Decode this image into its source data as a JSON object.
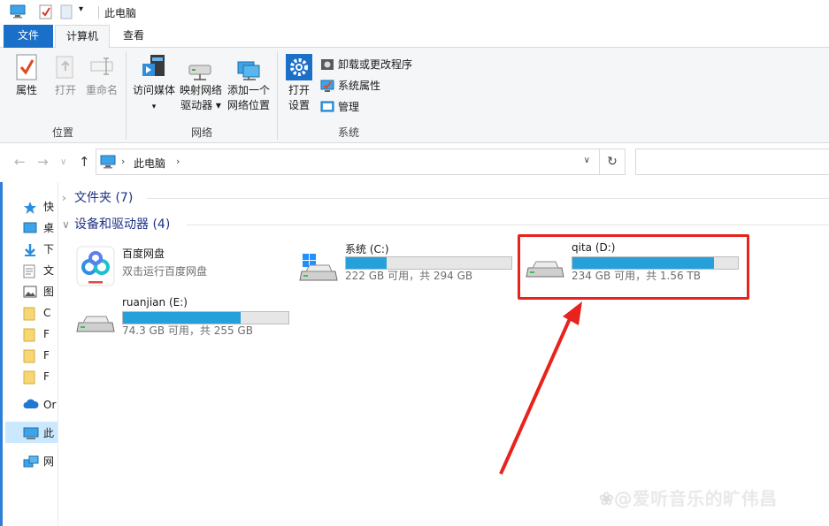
{
  "window": {
    "title": "此电脑",
    "qat_dropdown": "▾"
  },
  "ribbon_tabs": [
    {
      "label": "文件"
    },
    {
      "label": "计算机"
    },
    {
      "label": "查看"
    }
  ],
  "ribbon": {
    "location_group": {
      "label": "位置",
      "properties": "属性",
      "open": "打开",
      "rename": "重命名"
    },
    "network_group": {
      "label": "网络",
      "access_media_line1": "访问媒体",
      "access_media_caret": "▾",
      "map_drive_line1": "映射网络",
      "map_drive_line2": "驱动器 ▾",
      "add_location_line1": "添加一个",
      "add_location_line2": "网络位置"
    },
    "system_group": {
      "label": "系统",
      "open_settings_line1": "打开",
      "open_settings_line2": "设置",
      "uninstall": "卸载或更改程序",
      "system_properties": "系统属性",
      "manage": "管理"
    }
  },
  "address": {
    "back": "←",
    "forward": "→",
    "recent": "∨",
    "up": "↑",
    "path_sep1": "›",
    "path": "此电脑",
    "path_sep2": "›",
    "dropdown": "∨",
    "refresh": "↻"
  },
  "nav_pane": [
    {
      "label": "快",
      "icon": "star-icon"
    },
    {
      "label": "桌",
      "icon": "desktop-icon"
    },
    {
      "label": "下",
      "icon": "download-icon"
    },
    {
      "label": "文",
      "icon": "document-icon"
    },
    {
      "label": "图",
      "icon": "picture-icon"
    },
    {
      "label": "C",
      "icon": "folder-icon"
    },
    {
      "label": "F",
      "icon": "folder-icon"
    },
    {
      "label": "F",
      "icon": "folder-icon"
    },
    {
      "label": "F",
      "icon": "folder-icon"
    },
    {
      "label": "Or",
      "icon": "cloud-icon"
    },
    {
      "label": "此",
      "icon": "pc-icon"
    },
    {
      "label": "网",
      "icon": "network-icon"
    }
  ],
  "groups": {
    "folders": {
      "chevron": "›",
      "label": "文件夹 (7)"
    },
    "devices": {
      "chevron": "∨",
      "label": "设备和驱动器 (4)"
    }
  },
  "devices": [
    {
      "name": "百度网盘",
      "sub": "双击运行百度网盘",
      "icon": "baidu-netdisk-icon"
    },
    {
      "name": "系统 (C:)",
      "sub": "222 GB 可用，共 294 GB",
      "used_fraction": 0.245,
      "icon": "windows-drive-icon"
    },
    {
      "name": "qita (D:)",
      "sub": "234 GB 可用，共 1.56 TB",
      "used_fraction": 0.854,
      "icon": "drive-icon"
    },
    {
      "name": "ruanjian (E:)",
      "sub": "74.3 GB 可用，共 255 GB",
      "used_fraction": 0.709,
      "icon": "drive-icon"
    }
  ],
  "colors": {
    "accent": "#1a6fc9",
    "bar_fill": "#26a0da",
    "annotation_red": "#e8221c",
    "selected": "#cce8ff"
  },
  "watermark": {
    "paw": "❀",
    "text": "@爱听音乐的旷伟昌"
  }
}
